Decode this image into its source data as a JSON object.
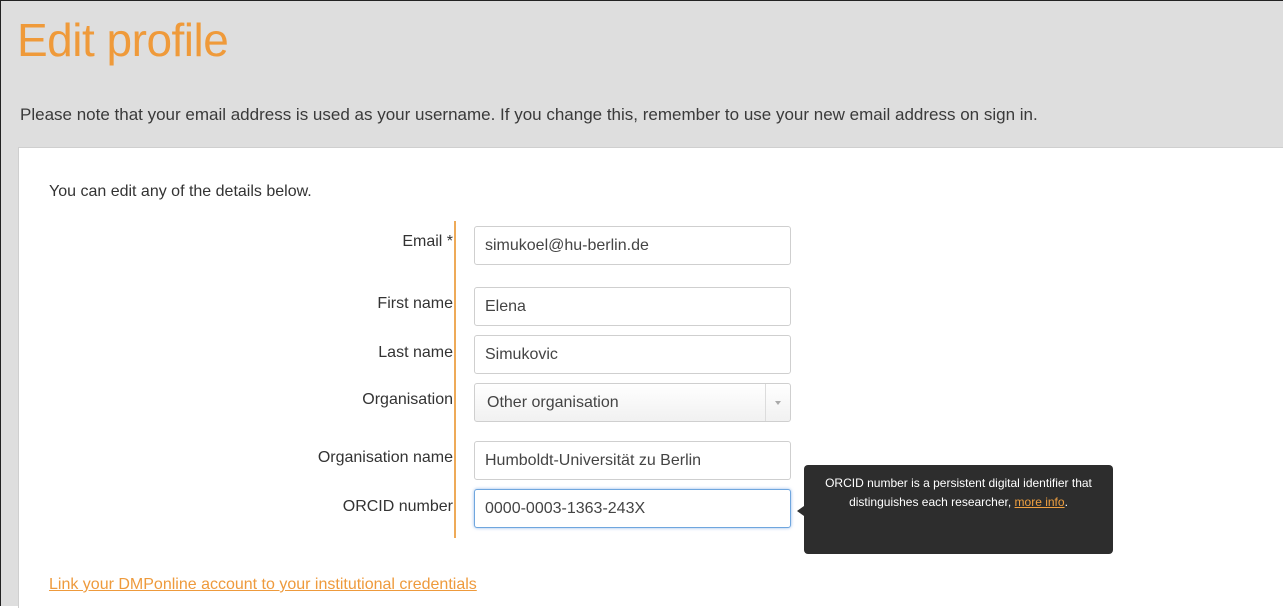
{
  "page": {
    "title": "Edit profile",
    "note": "Please note that your email address is used as your username. If you change this, remember to use your new email address on sign in."
  },
  "form": {
    "intro": "You can edit any of the details below.",
    "email": {
      "label": "Email *",
      "value": "simukoel@hu-berlin.de"
    },
    "first_name": {
      "label": "First name",
      "value": "Elena"
    },
    "last_name": {
      "label": "Last name",
      "value": "Simukovic"
    },
    "organisation": {
      "label": "Organisation",
      "selected": "Other organisation"
    },
    "organisation_name": {
      "label": "Organisation name",
      "value": "Humboldt-Universität zu Berlin"
    },
    "orcid": {
      "label": "ORCID number",
      "value": "0000-0003-1363-243X"
    }
  },
  "tooltip": {
    "text": "ORCID number is a persistent digital identifier that distinguishes each researcher,",
    "link": "more info",
    "end": "."
  },
  "link_credentials": "Link your DMPonline account to your institutional credentials",
  "colors": {
    "accent": "#ef9a3a",
    "background": "#dedede",
    "tooltip_bg": "#2d2d2d"
  }
}
